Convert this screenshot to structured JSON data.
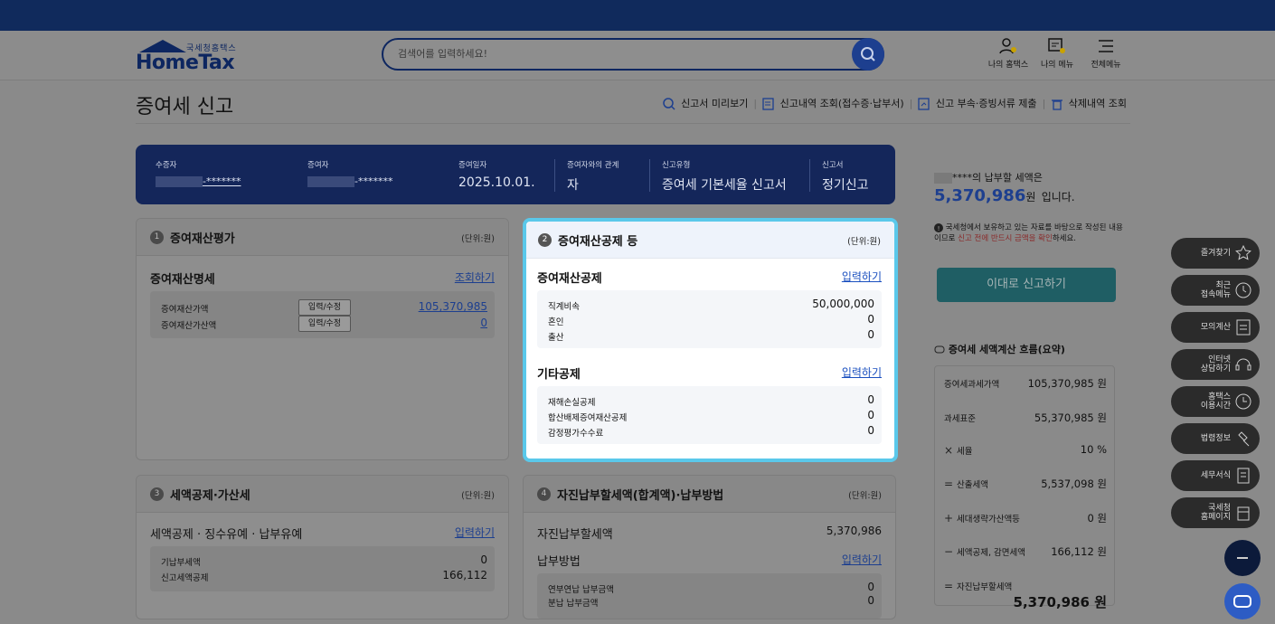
{
  "logo": {
    "small": "국세청홈택스",
    "big": "HomeTax"
  },
  "search": {
    "placeholder": "검색어를 입력하세요!"
  },
  "header_icons": [
    {
      "label": "나의 홈택스"
    },
    {
      "label": "나의 메뉴"
    },
    {
      "label": "전체메뉴"
    }
  ],
  "page": {
    "title": "증여세 신고"
  },
  "top_links": [
    "신고서 미리보기",
    "신고내역 조회(접수증·납부서)",
    "신고 부속·증빙서류 제출",
    "삭제내역 조회"
  ],
  "info": {
    "donee": {
      "label": "수증자",
      "value": "-*******"
    },
    "donor": {
      "label": "증여자",
      "value": "-*******"
    },
    "date": {
      "label": "증여일자",
      "value": "2025.10.01."
    },
    "relation": {
      "label": "증여자와의 관계",
      "value": "자"
    },
    "type": {
      "label": "신고유형",
      "value": "증여세 기본세율 신고서"
    },
    "form": {
      "label": "신고서",
      "value": "정기신고"
    }
  },
  "card1": {
    "num": "1",
    "title": "증여재산평가",
    "unit": "(단위:원)",
    "section": "증여재산명세",
    "link": "조회하기",
    "edit": "입력/수정",
    "rows": [
      {
        "label": "증여재산가액",
        "value": "105,370,985"
      },
      {
        "label": "증여재산가산액",
        "value": "0"
      }
    ]
  },
  "card2": {
    "num": "2",
    "title": "증여재산공제 등",
    "unit": "(단위:원)",
    "sec1": {
      "title": "증여재산공제",
      "link": "입력하기",
      "rows": [
        {
          "label": "직계비속",
          "value": "50,000,000"
        },
        {
          "label": "혼인",
          "value": "0"
        },
        {
          "label": "출산",
          "value": "0"
        }
      ]
    },
    "sec2": {
      "title": "기타공제",
      "link": "입력하기",
      "rows": [
        {
          "label": "재해손실공제",
          "value": "0"
        },
        {
          "label": "합산배제증여재산공제",
          "value": "0"
        },
        {
          "label": "감정평가수수료",
          "value": "0"
        }
      ]
    }
  },
  "card3": {
    "num": "3",
    "title": "세액공제·가산세",
    "unit": "(단위:원)",
    "section": "세액공제 · 징수유예 · 납부유예",
    "link": "입력하기",
    "rows": [
      {
        "label": "기납부세액",
        "value": "0"
      },
      {
        "label": "신고세액공제",
        "value": "166,112"
      }
    ]
  },
  "card4": {
    "num": "4",
    "title": "자진납부할세액(합계액)·납부방법",
    "unit": "(단위:원)",
    "sec1": {
      "title": "자진납부할세액",
      "value": "5,370,986"
    },
    "sec2": {
      "title": "납부방법",
      "link": "입력하기",
      "rows": [
        {
          "label": "연부연납 납부금액",
          "value": "0"
        },
        {
          "label": "분납 납부금액",
          "value": "0"
        }
      ]
    }
  },
  "side": {
    "masked": "****의 납부할 세액은",
    "amount": "5,370,986",
    "amount_unit": "원",
    "amount_suffix": "입니다.",
    "notice_a": "국세청에서 보유하고 있는 자료를 바탕으로 작성된 내용이므로 ",
    "notice_red": "신고 전에 반드시 금액을 확인",
    "notice_b": "하세요.",
    "submit": "이대로 신고하기",
    "flow_title": "증여세 세액계산 흐름(요약)",
    "flow": [
      {
        "op": "",
        "label": "증여세과세가액",
        "value": "105,370,985 원"
      },
      {
        "op": "",
        "label": "과세표준",
        "value": "55,370,985 원"
      },
      {
        "op": "×",
        "label": "세율",
        "value": "10 %"
      },
      {
        "op": "=",
        "label": "산출세액",
        "value": "5,537,098 원"
      },
      {
        "op": "+",
        "label": "세대생략가산액등",
        "value": "0 원"
      },
      {
        "op": "−",
        "label": "세액공제, 감면세액",
        "value": "166,112 원"
      },
      {
        "op": "=",
        "label": "자진납부할세액",
        "value": "5,370,986 원"
      }
    ]
  },
  "fabs": [
    {
      "label": "즐겨찾기"
    },
    {
      "label": "최근\n접속메뉴"
    },
    {
      "label": "모의계산"
    },
    {
      "label": "인터넷\n상담하기"
    },
    {
      "label": "홈택스\n이용시간"
    },
    {
      "label": "법령정보"
    },
    {
      "label": "세무서식"
    },
    {
      "label": "국세청\n홈페이지"
    }
  ]
}
